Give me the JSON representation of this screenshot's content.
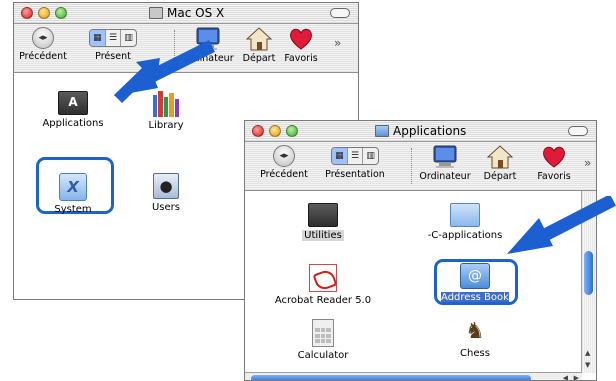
{
  "window1": {
    "title": "Mac OS X",
    "toolbar": {
      "back": "Précédent",
      "view": "Présentation",
      "view_visible": "Présent",
      "computer": "Ordinateur",
      "home": "Départ",
      "favorites": "Favoris",
      "more": "»"
    },
    "items": [
      "Applications",
      "Library",
      "System",
      "Users"
    ]
  },
  "window2": {
    "title": "Applications",
    "toolbar": {
      "back": "Précédent",
      "view": "Présentation",
      "computer": "Ordinateur",
      "home": "Départ",
      "favorites": "Favoris",
      "more": "»"
    },
    "items": [
      "Utilities",
      "-C-applications",
      "Acrobat Reader 5.0",
      "Address Book",
      "Calculator",
      "Chess"
    ]
  },
  "colors": {
    "highlight": "#1d63c9",
    "arrow": "#1c5fd0",
    "selection": "#3d6dc9"
  },
  "icons": [
    "folder-icon",
    "library-icon",
    "system-icon",
    "users-icon",
    "acrobat-icon",
    "address-book-icon",
    "calculator-icon",
    "chess-icon",
    "back-icon",
    "view-icon",
    "computer-icon",
    "home-icon",
    "heart-icon"
  ]
}
